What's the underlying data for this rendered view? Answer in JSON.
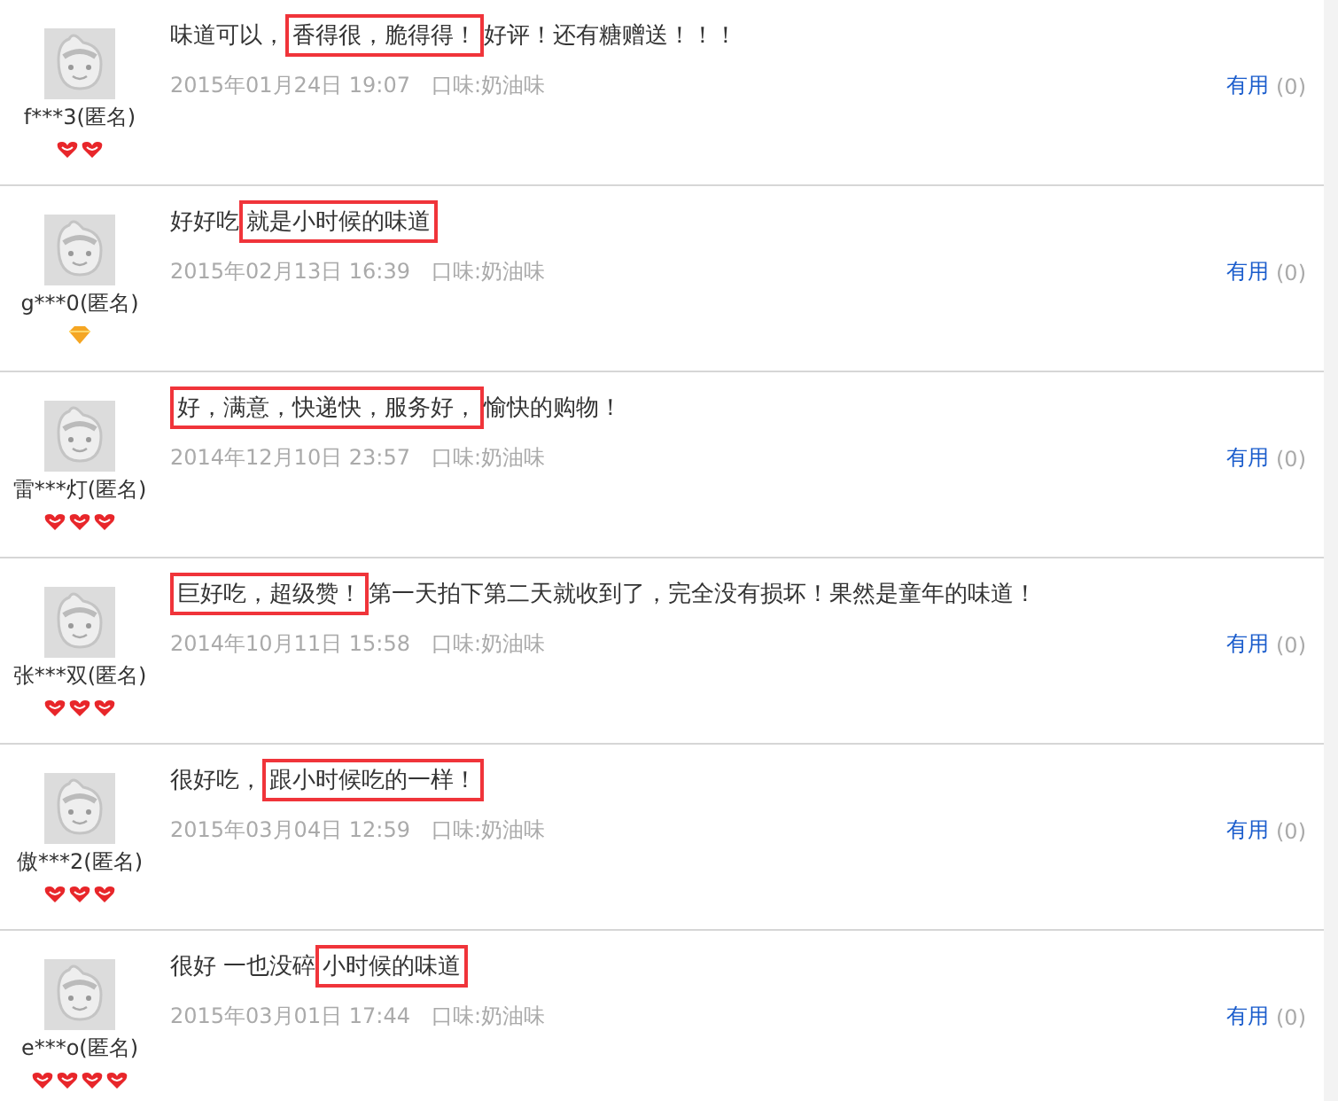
{
  "reviews": [
    {
      "user": "f***3(匿名)",
      "rank_icons": [
        {
          "kind": "heart"
        },
        {
          "kind": "heart"
        }
      ],
      "comment": {
        "before": "味道可以，",
        "highlight": "香得很，脆得得！",
        "after": "好评！还有糖赠送！！！"
      },
      "date": "2015年01月24日 19:07",
      "flavor": "口味:奶油味",
      "useful": "有用",
      "useful_count": "(0)"
    },
    {
      "user": "g***0(匿名)",
      "rank_icons": [
        {
          "kind": "diamond"
        }
      ],
      "comment": {
        "before": "好好吃",
        "highlight": "就是小时候的味道"
      },
      "date": "2015年02月13日 16:39",
      "flavor": "口味:奶油味",
      "useful": "有用",
      "useful_count": "(0)"
    },
    {
      "user": "雷***灯(匿名)",
      "rank_icons": [
        {
          "kind": "heart"
        },
        {
          "kind": "heart"
        },
        {
          "kind": "heart"
        }
      ],
      "comment": {
        "highlight": "好，满意，快递快，服务好，",
        "after": "愉快的购物！"
      },
      "date": "2014年12月10日 23:57",
      "flavor": "口味:奶油味",
      "useful": "有用",
      "useful_count": "(0)"
    },
    {
      "user": "张***双(匿名)",
      "rank_icons": [
        {
          "kind": "heart"
        },
        {
          "kind": "heart"
        },
        {
          "kind": "heart"
        }
      ],
      "comment": {
        "highlight": "巨好吃，超级赞！",
        "after": "第一天拍下第二天就收到了，完全没有损坏！果然是童年的味道！"
      },
      "date": "2014年10月11日 15:58",
      "flavor": "口味:奶油味",
      "useful": "有用",
      "useful_count": "(0)"
    },
    {
      "user": "傲***2(匿名)",
      "rank_icons": [
        {
          "kind": "heart"
        },
        {
          "kind": "heart"
        },
        {
          "kind": "heart"
        }
      ],
      "comment": {
        "before": "很好吃，",
        "highlight": "跟小时候吃的一样！"
      },
      "date": "2015年03月04日 12:59",
      "flavor": "口味:奶油味",
      "useful": "有用",
      "useful_count": "(0)"
    },
    {
      "user": "e***o(匿名)",
      "rank_icons": [
        {
          "kind": "heart"
        },
        {
          "kind": "heart"
        },
        {
          "kind": "heart"
        },
        {
          "kind": "heart"
        }
      ],
      "comment": {
        "before": "很好 一也没碎",
        "highlight": "小时候的味道"
      },
      "date": "2015年03月01日 17:44",
      "flavor": "口味:奶油味",
      "useful": "有用",
      "useful_count": "(0)"
    }
  ]
}
